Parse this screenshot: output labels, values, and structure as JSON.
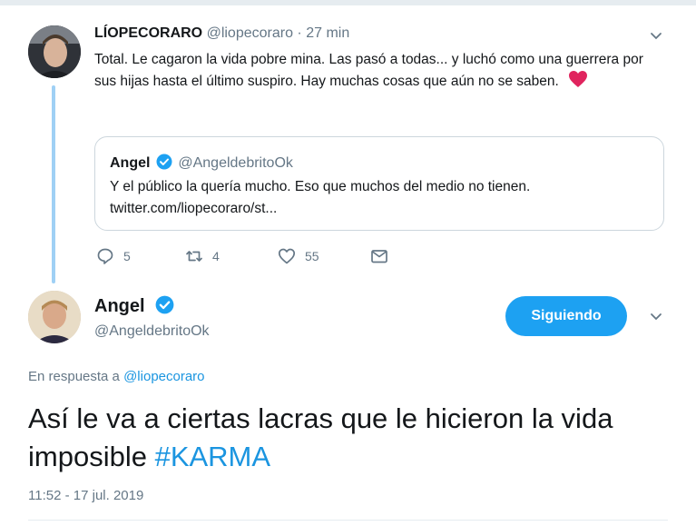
{
  "parent_tweet": {
    "author_name": "LÍOPECORARO",
    "author_handle": "@liopecoraro",
    "separator": " · ",
    "time_ago": "27 min",
    "text": "Total. Le cagaron la vida pobre mina. Las pasó a todas... y luchó como una guerrera por sus hijas hasta el último suspiro. Hay muchas cosas que aún no se saben.",
    "emoji_icon": "red-heart-icon",
    "quoted_tweet": {
      "author_name": "Angel",
      "author_handle": "@AngeldebritoOk",
      "text": "Y el público la quería mucho. Eso que muchos del medio no tienen.",
      "link": "twitter.com/liopecoraro/st..."
    },
    "actions": {
      "reply_count": "5",
      "retweet_count": "4",
      "like_count": "55"
    }
  },
  "main_tweet": {
    "author_name": "Angel",
    "author_handle": "@AngeldebritoOk",
    "follow_label": "Siguiendo",
    "reply_prefix": "En respuesta a",
    "reply_mention": "@liopecoraro",
    "text": "Así le va a ciertas lacras que le hicieron la vida imposible",
    "hashtag": "#KARMA",
    "timestamp": "11:52 - 17 jul. 2019"
  },
  "colors": {
    "accent": "#1da1f2",
    "link": "#1b95e0",
    "muted": "#657786",
    "heart": "#e0245e",
    "thread_line": "#9fd0f5"
  }
}
